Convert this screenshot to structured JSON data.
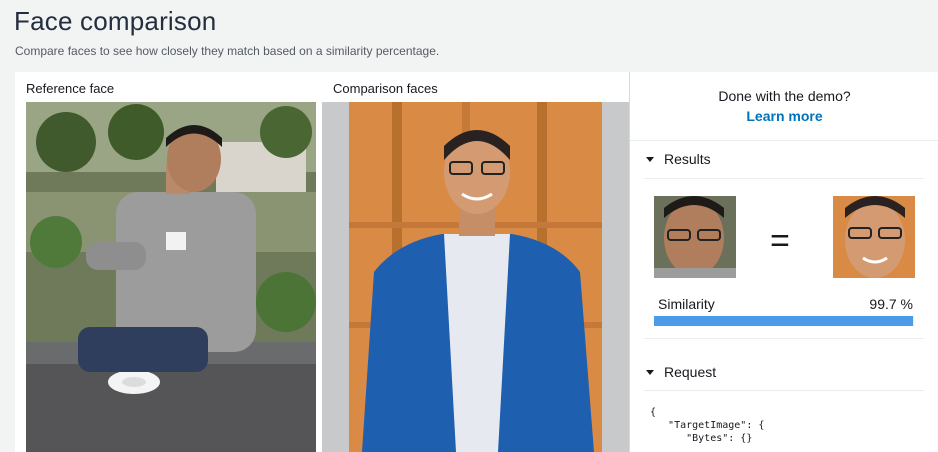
{
  "page": {
    "title": "Face comparison",
    "subtitle": "Compare faces to see how closely they match based on a similarity percentage."
  },
  "reference": {
    "label": "Reference face"
  },
  "comparison": {
    "label": "Comparison faces"
  },
  "sidebar": {
    "demo_text": "Done with the demo?",
    "learn_more": "Learn more",
    "results": {
      "header": "Results",
      "equals_symbol": "=",
      "similarity_label": "Similarity",
      "similarity_value": "99.7 %",
      "similarity_fraction": 0.997
    },
    "request": {
      "header": "Request",
      "code": "{\n   \"TargetImage\": {\n      \"Bytes\": {}"
    }
  },
  "colors": {
    "accent": "#0073bb",
    "similarity_bar": "#4c9be8",
    "background": "#f2f3f3"
  }
}
